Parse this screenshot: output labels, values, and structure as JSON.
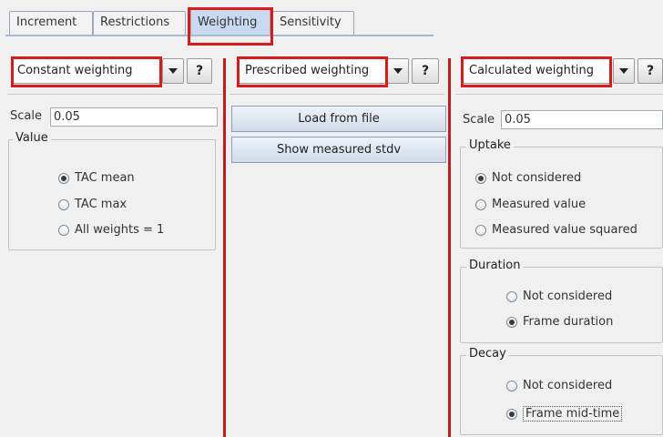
{
  "tabs": [
    {
      "label": "Increment"
    },
    {
      "label": "Restrictions"
    },
    {
      "label": "Weighting",
      "selected": true
    },
    {
      "label": "Sensitivity"
    }
  ],
  "left_panel": {
    "combo_value": "Constant weighting",
    "help_label": "?",
    "scale_label": "Scale",
    "scale_value": "0.05",
    "group_title": "Value",
    "options": [
      {
        "label": "TAC mean",
        "checked": true
      },
      {
        "label": "TAC max",
        "checked": false
      },
      {
        "label": "All weights = 1",
        "checked": false
      }
    ]
  },
  "middle_panel": {
    "combo_value": "Prescribed weighting",
    "help_label": "?",
    "buttons": [
      {
        "label": "Load from file"
      },
      {
        "label": "Show measured stdv"
      }
    ]
  },
  "right_panel": {
    "combo_value": "Calculated weighting",
    "help_label": "?",
    "scale_label": "Scale",
    "scale_value": "0.05",
    "uptake": {
      "title": "Uptake",
      "options": [
        {
          "label": "Not considered",
          "checked": true
        },
        {
          "label": "Measured value",
          "checked": false
        },
        {
          "label": "Measured value squared",
          "checked": false
        }
      ]
    },
    "duration": {
      "title": "Duration",
      "options": [
        {
          "label": "Not considered",
          "checked": false
        },
        {
          "label": "Frame duration",
          "checked": true
        }
      ]
    },
    "decay": {
      "title": "Decay",
      "options": [
        {
          "label": "Not considered",
          "checked": false
        },
        {
          "label": "Frame mid-time",
          "checked": true
        }
      ]
    }
  },
  "colors": {
    "highlight": "#dd1a1a",
    "divider": "#c21d1d",
    "selected_tab": "#c9daf0"
  }
}
